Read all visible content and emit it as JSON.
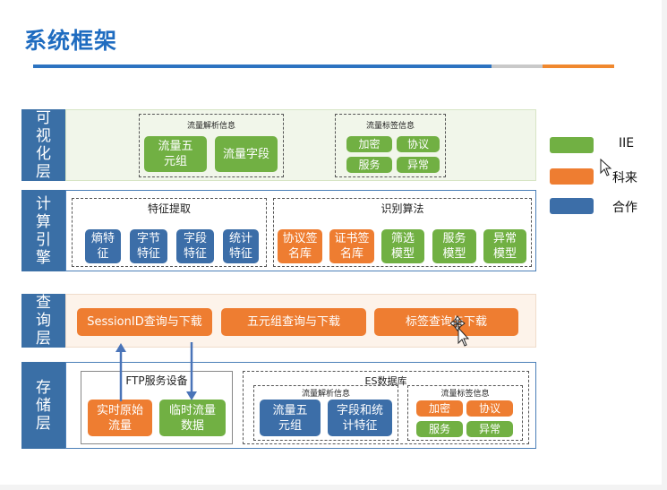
{
  "title": "系统框架",
  "layers": {
    "visualization": {
      "label": "可视化层",
      "flow_parse": {
        "title": "流量解析信息",
        "items": [
          "流量五元组",
          "流量字段"
        ]
      },
      "flow_tag": {
        "title": "流量标签信息",
        "items": [
          "加密",
          "协议",
          "服务",
          "异常"
        ]
      }
    },
    "compute": {
      "label": "计算引擎",
      "features": {
        "title": "特征提取",
        "items": [
          "熵特征",
          "字节特征",
          "字段特征",
          "统计特征"
        ]
      },
      "algorithms": {
        "title": "识别算法",
        "items": [
          "协议签名库",
          "证书签名库",
          "筛选模型",
          "服务模型",
          "异常模型"
        ]
      }
    },
    "query": {
      "label": "查询层",
      "items": [
        "SessionID查询与下载",
        "五元组查询与下载",
        "标签查询与下载"
      ]
    },
    "storage": {
      "label": "存储层",
      "ftp": {
        "title": "FTP服务设备",
        "items": [
          "实时原始流量",
          "临时流量数据"
        ]
      },
      "es": {
        "title": "ES数据库",
        "flow_parse": {
          "title": "流量解析信息",
          "items": [
            "流量五元组",
            "字段和统计特征"
          ]
        },
        "flow_tag": {
          "title": "流量标签信息",
          "items": [
            "加密",
            "协议",
            "服务",
            "异常"
          ]
        }
      }
    }
  },
  "legend": [
    {
      "label": "IIE",
      "color": "#71b043"
    },
    {
      "label": "科来",
      "color": "#ee7d31"
    },
    {
      "label": "合作",
      "color": "#3c6ea8"
    }
  ],
  "colors": {
    "title": "#1f6cc0",
    "green": "#71b043",
    "orange": "#ee7d31",
    "blue": "#3c6ea8"
  },
  "icons": [
    "move-cursor-icon",
    "mouse-pointer-icon"
  ]
}
